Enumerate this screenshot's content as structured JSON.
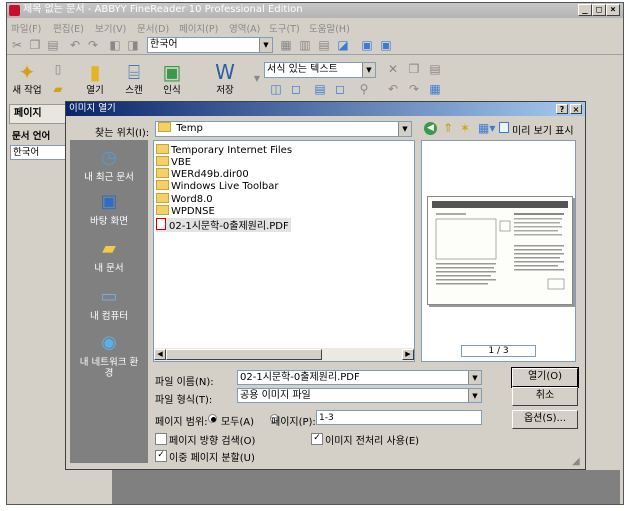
{
  "app": {
    "title": "제목 없는 문서 - ABBYY FineReader 10 Professional Edition",
    "window_buttons": [
      "_",
      "□",
      "×"
    ]
  },
  "menu": [
    "파일(F)",
    "편집(E)",
    "보기(V)",
    "문서(D)",
    "페이지(P)",
    "영역(A)",
    "도구(T)",
    "도움말(H)"
  ],
  "toolbar1": {
    "language": "한국어"
  },
  "toolbar2": {
    "new_task": "새 작업",
    "open": "열기",
    "scan": "스캔",
    "read": "인식",
    "save": "저장",
    "format": "서식 있는 텍스트"
  },
  "left_pane": {
    "tab": "페이지",
    "doc_language_label": "문서 언어",
    "doc_language": "한국어"
  },
  "dialog": {
    "title": "이미지 열기",
    "title_buttons": [
      "?",
      "×"
    ],
    "look_in_label": "찾는 위치(I):",
    "look_in_value": "Temp",
    "preview_toggle": "미리 보기 표시",
    "places": [
      "내 최근 문서",
      "바탕 화면",
      "내 문서",
      "내 컴퓨터",
      "내 네트워크 환경"
    ],
    "files": [
      {
        "name": "Temporary Internet Files",
        "type": "folder"
      },
      {
        "name": "VBE",
        "type": "folder"
      },
      {
        "name": "WERd49b.dir00",
        "type": "folder"
      },
      {
        "name": "Windows Live Toolbar",
        "type": "folder"
      },
      {
        "name": "Word8.0",
        "type": "folder"
      },
      {
        "name": "WPDNSE",
        "type": "folder"
      },
      {
        "name": "02-1시문학-0출제원리.PDF",
        "type": "pdf",
        "selected": true
      }
    ],
    "page_indicator": "1 / 3",
    "filename_label": "파일 이름(N):",
    "filename_value": "02-1시문학-0출제원리.PDF",
    "filetype_label": "파일 형식(T):",
    "filetype_value": "공용 이미지 파일",
    "page_range_label": "페이지 범위:",
    "all_label": "모두(A)",
    "pages_label": "페이지(P):",
    "pages_value": "1-3",
    "detect_orientation_label": "페이지 방향 검색(O)",
    "split_pages_label": "이중 페이지 분할(U)",
    "preprocess_label": "이미지 전처리 사용(E)",
    "open_button": "열기(O)",
    "cancel_button": "취소",
    "options_button": "옵션(S)..."
  }
}
